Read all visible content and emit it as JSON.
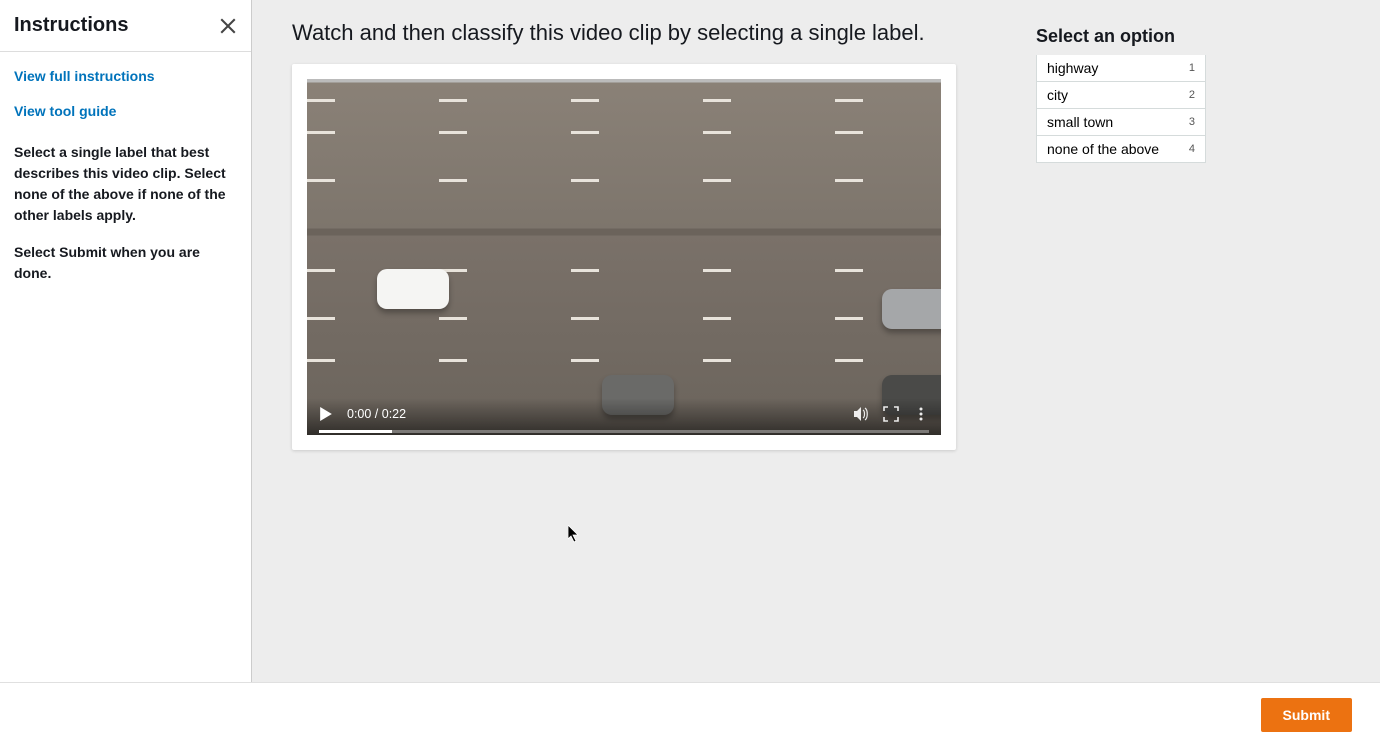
{
  "sidebar": {
    "title": "Instructions",
    "link_full": "View full instructions",
    "link_tool": "View tool guide",
    "text1": "Select a single label that best describes this video clip. Select none of the above if none of the other labels apply.",
    "text2": "Select Submit when you are done."
  },
  "main": {
    "heading": "Watch and then classify this video clip by selecting a single label.",
    "video": {
      "time": "0:00 / 0:22"
    }
  },
  "options": {
    "title": "Select an option",
    "items": [
      {
        "label": "highway",
        "key": "1"
      },
      {
        "label": "city",
        "key": "2"
      },
      {
        "label": "small town",
        "key": "3"
      },
      {
        "label": "none of the above",
        "key": "4"
      }
    ]
  },
  "footer": {
    "submit": "Submit"
  }
}
